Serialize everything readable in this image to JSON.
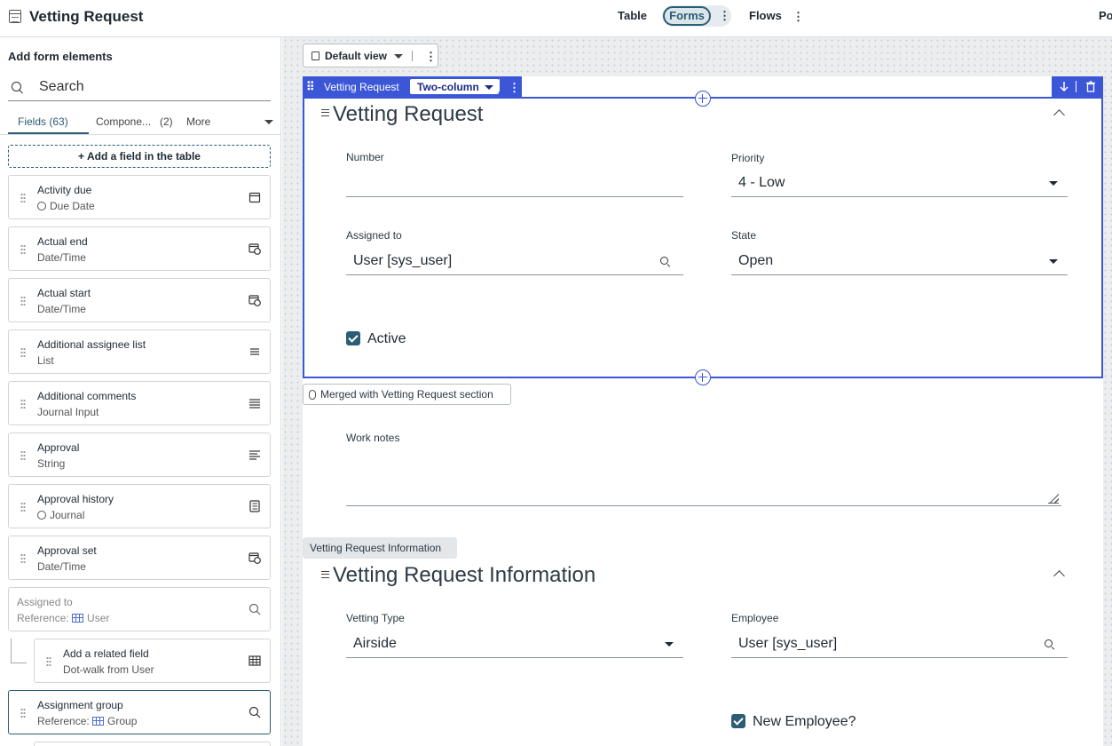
{
  "header": {
    "app_title": "Vetting Request",
    "tabs": [
      {
        "label": "Table"
      },
      {
        "label": "Forms",
        "active": true
      },
      {
        "label": "Flows"
      }
    ],
    "truncated_right_text": "Po"
  },
  "left_panel": {
    "heading": "Add form elements",
    "search": {
      "placeholder": "Search",
      "value": ""
    },
    "tabs": [
      {
        "label": "Fields (63)"
      },
      {
        "label": "Compone...",
        "count": "(2)"
      },
      {
        "label": "More"
      }
    ],
    "add_field_label": "+ Add a field in the table",
    "fields": [
      {
        "name": "Activity due",
        "type": "Due Date",
        "icon": "calendar-icon"
      },
      {
        "name": "Actual end",
        "type": "Date/Time",
        "icon": "calendar-clock-icon"
      },
      {
        "name": "Actual start",
        "type": "Date/Time",
        "icon": "calendar-clock-icon"
      },
      {
        "name": "Additional assignee list",
        "type": "List",
        "icon": "list-icon"
      },
      {
        "name": "Additional comments",
        "type": "Journal Input",
        "icon": "lines-icon"
      },
      {
        "name": "Approval",
        "type": "String",
        "icon": "text-align-icon"
      },
      {
        "name": "Approval history",
        "type": "Journal",
        "icon": "journal-icon"
      },
      {
        "name": "Approval set",
        "type": "Date/Time",
        "icon": "calendar-clock-icon"
      },
      {
        "name": "Assigned to",
        "type": "Reference:",
        "ref": "User",
        "icon": "search-icon",
        "disabled": true
      },
      {
        "name": "Add a related field",
        "type": "Dot-walk from User",
        "icon": "table-icon"
      },
      {
        "name": "Assignment group",
        "type": "Reference:",
        "ref": "Group",
        "icon": "search-icon"
      }
    ]
  },
  "canvas": {
    "view_label": "Default view",
    "section_toolbar": {
      "section_name": "Vetting Request",
      "layout": "Two-column"
    },
    "section1": {
      "title": "Vetting Request",
      "number_label": "Number",
      "number_value": "",
      "priority_label": "Priority",
      "priority_value": "4 - Low",
      "assigned_label": "Assigned to",
      "assigned_value": "User [sys_user]",
      "state_label": "State",
      "state_value": "Open",
      "active_label": "Active",
      "active_checked": true
    },
    "merged_text": "Merged with Vetting Request section",
    "work_notes_label": "Work notes",
    "info_tag": "Vetting Request Information",
    "section2": {
      "title": "Vetting Request Information",
      "vetting_type_label": "Vetting Type",
      "vetting_type_value": "Airside",
      "employee_label": "Employee",
      "employee_value": "User [sys_user]",
      "new_employee_label": "New Employee?",
      "new_employee_checked": true
    }
  },
  "colors": {
    "accent": "#2b5d74",
    "selection": "#3b57d8",
    "canvas_bg": "#ebedef"
  }
}
